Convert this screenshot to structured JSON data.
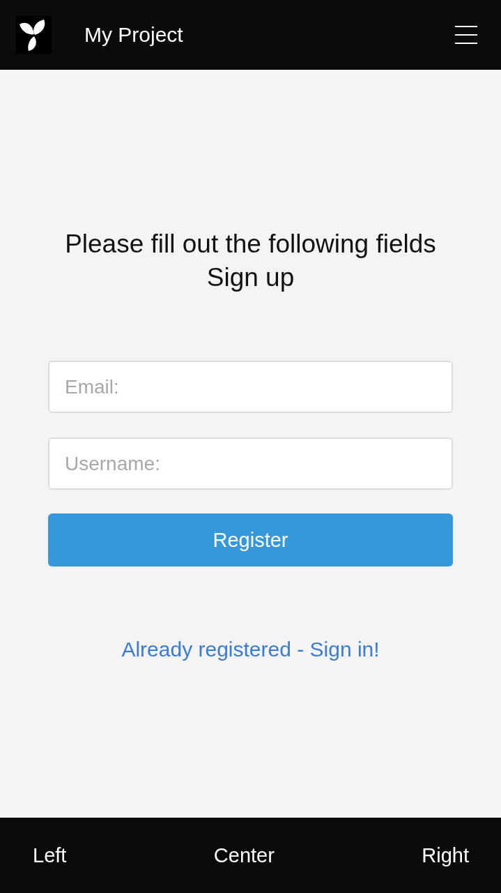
{
  "header": {
    "title": "My Project"
  },
  "form": {
    "heading": "Please fill out the following fields",
    "subheading": "Sign up",
    "fields": [
      {
        "placeholder": "Email:"
      },
      {
        "placeholder": "Username:"
      }
    ],
    "submit": "Register",
    "link": "Already registered - Sign in!"
  },
  "footer": {
    "items": [
      "Left",
      "Center",
      "Right"
    ]
  }
}
